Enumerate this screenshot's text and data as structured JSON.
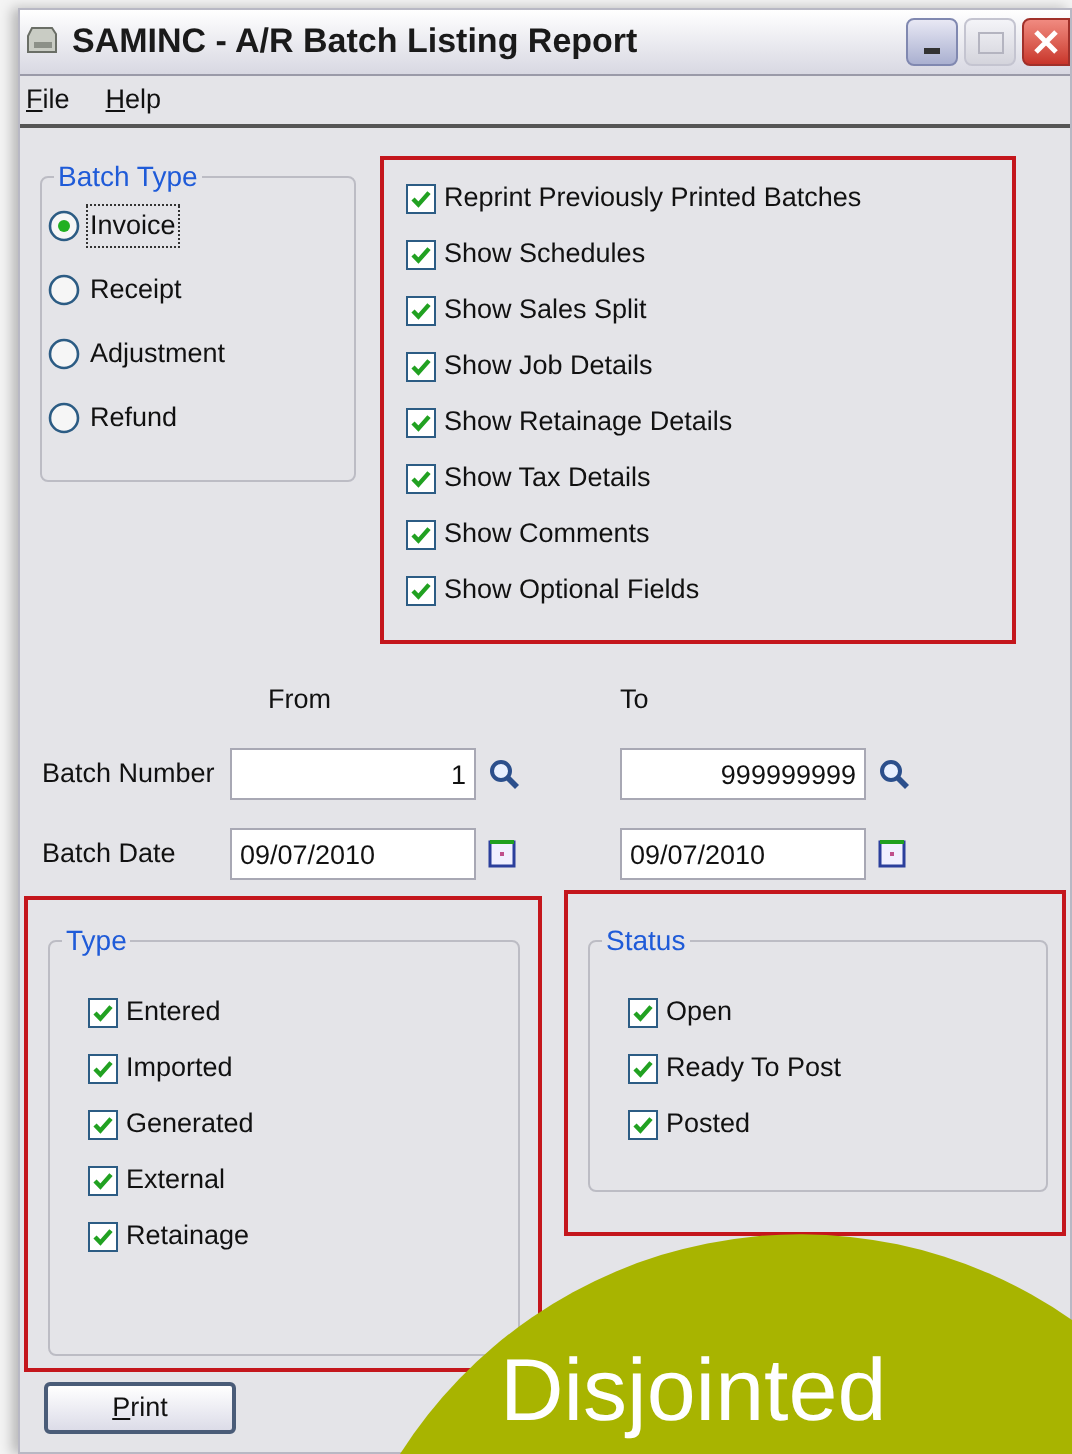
{
  "window": {
    "title": "SAMINC - A/R Batch Listing Report"
  },
  "menu": [
    {
      "label": "File"
    },
    {
      "label": "Help"
    }
  ],
  "batch_type": {
    "title": "Batch Type",
    "options": [
      {
        "label": "Invoice",
        "selected": true
      },
      {
        "label": "Receipt",
        "selected": false
      },
      {
        "label": "Adjustment",
        "selected": false
      },
      {
        "label": "Refund",
        "selected": false
      }
    ]
  },
  "options": {
    "highlighted": true,
    "items": [
      {
        "label": "Reprint Previously Printed Batches",
        "checked": true
      },
      {
        "label": "Show Schedules",
        "checked": true
      },
      {
        "label": "Show Sales Split",
        "checked": true
      },
      {
        "label": "Show Job Details",
        "checked": true
      },
      {
        "label": "Show Retainage Details",
        "checked": true
      },
      {
        "label": "Show Tax Details",
        "checked": true
      },
      {
        "label": "Show Comments",
        "checked": true
      },
      {
        "label": "Show Optional Fields",
        "checked": true
      }
    ]
  },
  "range": {
    "from_label": "From",
    "to_label": "To",
    "rows": [
      {
        "label": "Batch Number",
        "kind": "finder",
        "from": "1",
        "to": "999999999"
      },
      {
        "label": "Batch Date",
        "kind": "date",
        "from": "09/07/2010",
        "to": "09/07/2010"
      }
    ]
  },
  "type": {
    "title": "Type",
    "highlighted": true,
    "items": [
      {
        "label": "Entered",
        "checked": true
      },
      {
        "label": "Imported",
        "checked": true
      },
      {
        "label": "Generated",
        "checked": true
      },
      {
        "label": "External",
        "checked": true
      },
      {
        "label": "Retainage",
        "checked": true
      }
    ]
  },
  "status": {
    "title": "Status",
    "highlighted": true,
    "items": [
      {
        "label": "Open",
        "checked": true
      },
      {
        "label": "Ready To Post",
        "checked": true
      },
      {
        "label": "Posted",
        "checked": true
      }
    ]
  },
  "buttons": [
    {
      "label": "Print"
    }
  ],
  "callout": {
    "text": "Disjointed"
  }
}
